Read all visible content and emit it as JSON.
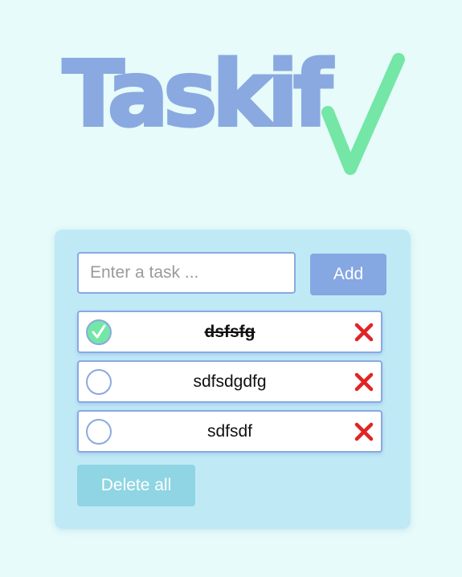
{
  "app": {
    "logo_text": "Taskif",
    "logo_color": "#8aa9e0",
    "check_color": "#74e6a6"
  },
  "form": {
    "input_placeholder": "Enter a task ...",
    "input_value": "",
    "add_label": "Add"
  },
  "tasks": [
    {
      "text": "dsfsfg",
      "done": true
    },
    {
      "text": "sdfsdgdfg",
      "done": false
    },
    {
      "text": "sdfsdf",
      "done": false
    }
  ],
  "footer": {
    "delete_all_label": "Delete all"
  },
  "icons": {
    "check": "check-icon",
    "delete": "red-x-icon"
  },
  "colors": {
    "background": "#e6fbfa",
    "card": "#c0e9f6",
    "accent": "#85a7e2",
    "delete_red": "#e02424",
    "delete_all_bg": "#8fd5e3"
  }
}
